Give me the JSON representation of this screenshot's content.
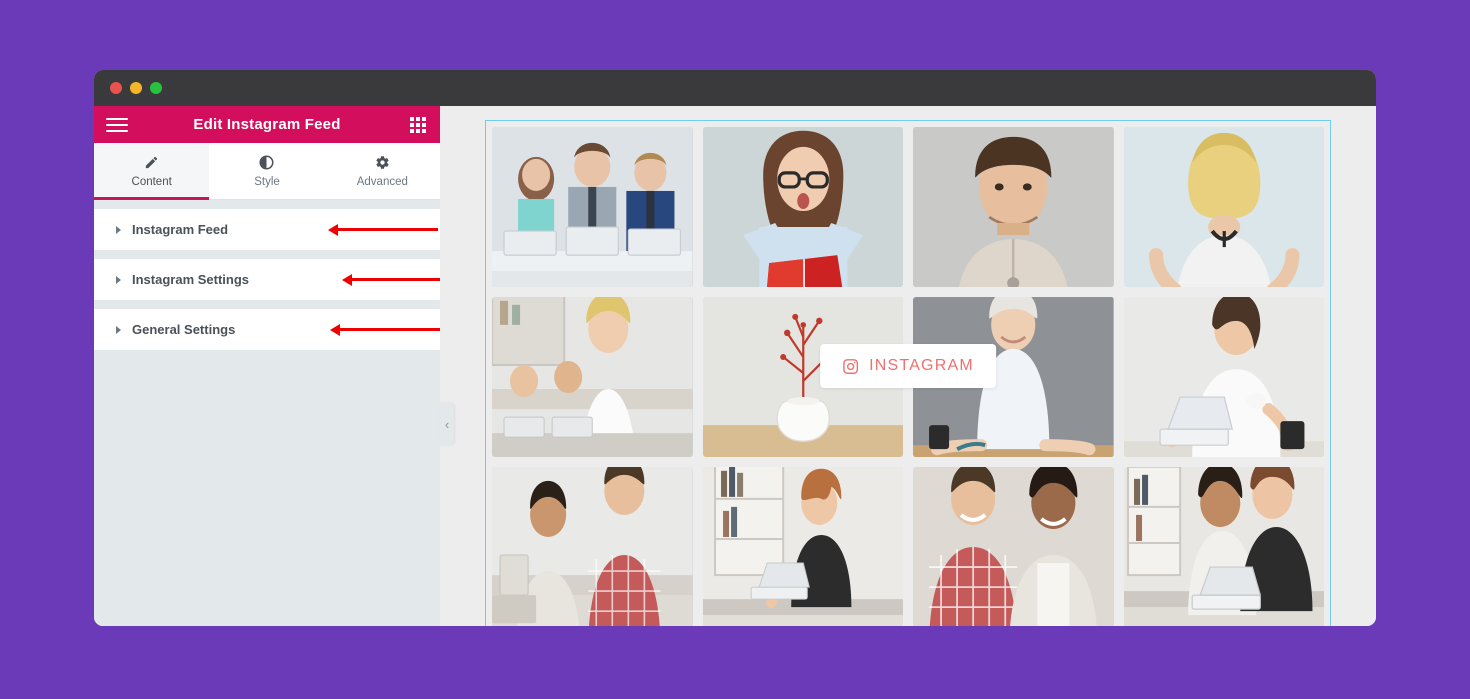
{
  "background_color": "#6a3ab9",
  "window": {
    "titlebar_color": "#3a3a3c",
    "traffic_lights": [
      {
        "name": "close",
        "color": "#e8534f"
      },
      {
        "name": "minimize",
        "color": "#f5b529"
      },
      {
        "name": "maximize",
        "color": "#27c33f"
      }
    ]
  },
  "panel": {
    "header": {
      "title": "Edit Instagram Feed",
      "accent_color": "#d30e5d",
      "menu_icon": "hamburger-menu-icon",
      "grid_icon": "widgets-grid-icon"
    },
    "tabs": [
      {
        "label": "Content",
        "icon": "pencil-icon",
        "active": true
      },
      {
        "label": "Style",
        "icon": "contrast-icon",
        "active": false
      },
      {
        "label": "Advanced",
        "icon": "gear-icon",
        "active": false
      }
    ],
    "sections": [
      {
        "label": "Instagram Feed",
        "expanded": false,
        "annotation_arrow": true
      },
      {
        "label": "Instagram Settings",
        "expanded": false,
        "annotation_arrow": true
      },
      {
        "label": "General Settings",
        "expanded": false,
        "annotation_arrow": true
      }
    ],
    "collapse_handle": "‹",
    "background_color": "#e3e8ea",
    "annotation_arrow_color": "#ee0000"
  },
  "canvas": {
    "background_color": "#ededed",
    "selection_border_color": "#71ccf0",
    "instagram_badge": {
      "label": "INSTAGRAM",
      "icon": "instagram-camera-icon",
      "color": "#ef7070"
    },
    "grid": {
      "columns": 4,
      "rows": 3,
      "tiles": [
        {
          "id": 1,
          "alt": "three office workers at laptops"
        },
        {
          "id": 2,
          "alt": "woman with glasses holding red book"
        },
        {
          "id": 3,
          "alt": "young man with beard portrait"
        },
        {
          "id": 4,
          "alt": "blonde woman back view"
        },
        {
          "id": 5,
          "alt": "smiling woman in white shirt with team"
        },
        {
          "id": 6,
          "alt": "white vase with dried flowers"
        },
        {
          "id": 7,
          "alt": "mature woman leaning on desk"
        },
        {
          "id": 8,
          "alt": "woman with laptop and coffee mug"
        },
        {
          "id": 9,
          "alt": "man in plaid shirt with coworkers"
        },
        {
          "id": 10,
          "alt": "woman at desk with bookshelf"
        },
        {
          "id": 11,
          "alt": "smiling man and woman colleagues"
        },
        {
          "id": 12,
          "alt": "two women working at laptop"
        }
      ]
    }
  }
}
